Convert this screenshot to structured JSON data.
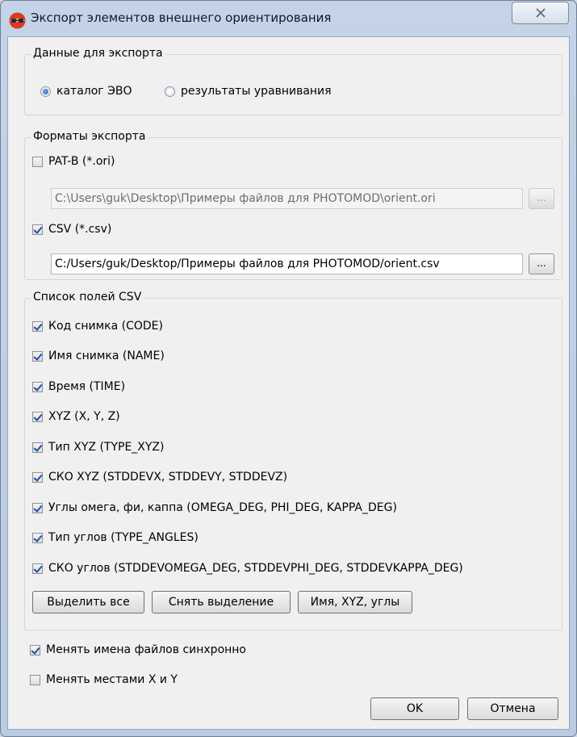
{
  "window": {
    "title": "Экспорт элементов внешнего ориентирования"
  },
  "export_data": {
    "group_title": "Данные для экспорта",
    "options": [
      {
        "label": "каталог ЭВО",
        "checked": true
      },
      {
        "label": "результаты уравнивания",
        "checked": false
      }
    ]
  },
  "formats": {
    "group_title": "Форматы экспорта",
    "patb": {
      "label": "PAT-B (*.ori)",
      "checked": false,
      "path": "C:\\Users\\guk\\Desktop\\Примеры файлов для PHOTOMOD\\orient.ori",
      "browse": "..."
    },
    "csv": {
      "label": "CSV (*.csv)",
      "checked": true,
      "path": "C:/Users/guk/Desktop/Примеры файлов для PHOTOMOD/orient.csv",
      "browse": "..."
    }
  },
  "csv_fields": {
    "group_title": "Список полей CSV",
    "fields": [
      {
        "label": "Код снимка (CODE)",
        "checked": true
      },
      {
        "label": "Имя снимка (NAME)",
        "checked": true
      },
      {
        "label": "Время (TIME)",
        "checked": true
      },
      {
        "label": "XYZ (X, Y, Z)",
        "checked": true
      },
      {
        "label": "Тип XYZ (TYPE_XYZ)",
        "checked": true
      },
      {
        "label": "СКО XYZ (STDDEVX, STDDEVY, STDDEVZ)",
        "checked": true
      },
      {
        "label": "Углы омега, фи, каппа (OMEGA_DEG, PHI_DEG, KAPPA_DEG)",
        "checked": true
      },
      {
        "label": "Тип углов (TYPE_ANGLES)",
        "checked": true
      },
      {
        "label": "СКО углов (STDDEVOMEGA_DEG, STDDEVPHI_DEG, STDDEVKAPPA_DEG)",
        "checked": true
      }
    ],
    "buttons": {
      "select_all": "Выделить все",
      "deselect": "Снять выделение",
      "name_xyz_angles": "Имя, XYZ, углы"
    }
  },
  "options": {
    "sync_names": {
      "label": "Менять имена файлов синхронно",
      "checked": true
    },
    "swap_xy": {
      "label": "Менять местами X и Y",
      "checked": false
    }
  },
  "footer": {
    "ok": "OK",
    "cancel": "Отмена"
  }
}
